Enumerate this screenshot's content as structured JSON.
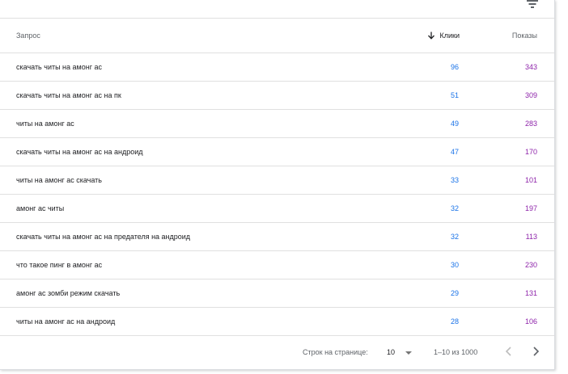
{
  "header": {
    "query": "Запрос",
    "clicks": "Клики",
    "impressions": "Показы"
  },
  "rows": [
    {
      "query": "скачать читы на амонг ас",
      "clicks": "96",
      "impressions": "343"
    },
    {
      "query": "скачать читы на амонг ас на пк",
      "clicks": "51",
      "impressions": "309"
    },
    {
      "query": "читы на амонг ас",
      "clicks": "49",
      "impressions": "283"
    },
    {
      "query": "скачать читы на амонг ас на андроид",
      "clicks": "47",
      "impressions": "170"
    },
    {
      "query": "читы на амонг ас скачать",
      "clicks": "33",
      "impressions": "101"
    },
    {
      "query": "амонг ас читы",
      "clicks": "32",
      "impressions": "197"
    },
    {
      "query": "скачать читы на амонг ас на предателя на андроид",
      "clicks": "32",
      "impressions": "113"
    },
    {
      "query": "что такое пинг в амонг ас",
      "clicks": "30",
      "impressions": "230"
    },
    {
      "query": "амонг ас зомби режим скачать",
      "clicks": "29",
      "impressions": "131"
    },
    {
      "query": "читы на амонг ас на андроид",
      "clicks": "28",
      "impressions": "106"
    }
  ],
  "footer": {
    "rows_per_page_label": "Строк на странице:",
    "rows_per_page_value": "10",
    "range": "1–10 из 1000"
  },
  "icons": {
    "filter": "filter-icon",
    "sort": "arrow-down-icon",
    "dropdown": "caret-down-icon",
    "prev": "chevron-left-icon",
    "next": "chevron-right-icon"
  },
  "colors": {
    "clicks": "#1a73e8",
    "impressions": "#8e24aa",
    "text": "#202124",
    "muted": "#5f6368",
    "divider": "#e0e0e0"
  }
}
